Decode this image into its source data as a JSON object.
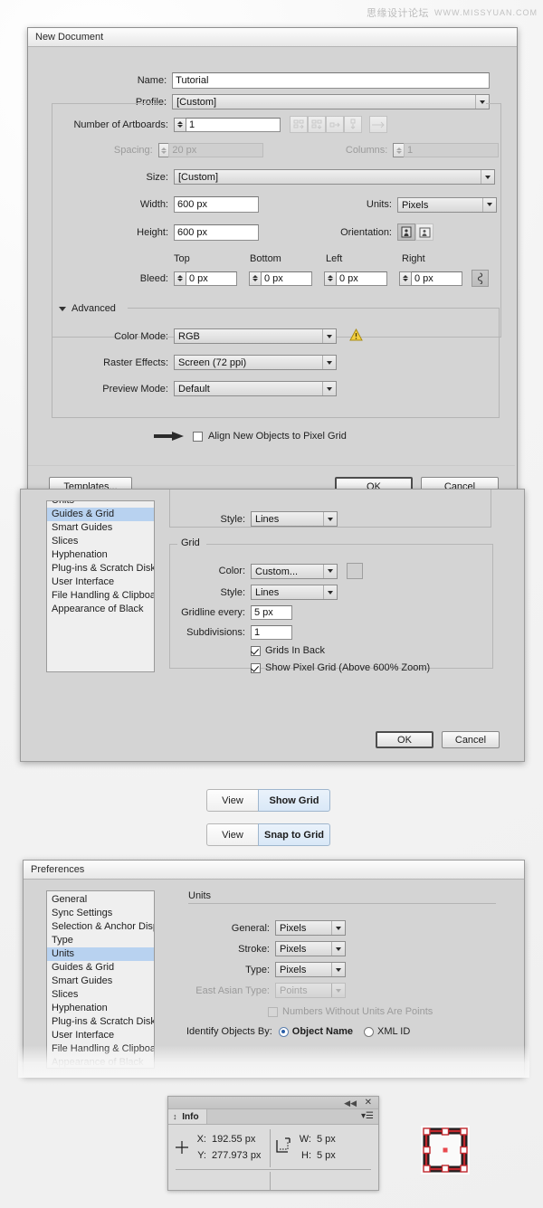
{
  "watermark": {
    "cn": "思缘设计论坛",
    "en": "WWW.MISSYUAN.COM"
  },
  "new_document": {
    "title": "New Document",
    "name_label": "Name:",
    "name_value": "Tutorial",
    "profile_label": "Profile:",
    "profile_value": "[Custom]",
    "artboards_label": "Number of Artboards:",
    "artboards_value": "1",
    "spacing_label": "Spacing:",
    "spacing_value": "20 px",
    "columns_label": "Columns:",
    "columns_value": "1",
    "size_label": "Size:",
    "size_value": "[Custom]",
    "width_label": "Width:",
    "width_value": "600 px",
    "units_label": "Units:",
    "units_value": "Pixels",
    "height_label": "Height:",
    "height_value": "600 px",
    "orientation_label": "Orientation:",
    "bleed_label": "Bleed:",
    "bleed_top_label": "Top",
    "bleed_top_value": "0 px",
    "bleed_bottom_label": "Bottom",
    "bleed_bottom_value": "0 px",
    "bleed_left_label": "Left",
    "bleed_left_value": "0 px",
    "bleed_right_label": "Right",
    "bleed_right_value": "0 px",
    "advanced_label": "Advanced",
    "color_mode_label": "Color Mode:",
    "color_mode_value": "RGB",
    "raster_label": "Raster Effects:",
    "raster_value": "Screen (72 ppi)",
    "preview_label": "Preview Mode:",
    "preview_value": "Default",
    "align_pixel_label": "Align New Objects to Pixel Grid",
    "align_pixel_checked": false,
    "templates_label": "Templates...",
    "ok_label": "OK",
    "cancel_label": "Cancel"
  },
  "prefs_grid": {
    "categories": [
      {
        "label": "Units",
        "selected": false,
        "dim": false,
        "clipped": true
      },
      {
        "label": "Guides & Grid",
        "selected": true,
        "dim": false
      },
      {
        "label": "Smart Guides",
        "selected": false,
        "dim": false
      },
      {
        "label": "Slices",
        "selected": false,
        "dim": false
      },
      {
        "label": "Hyphenation",
        "selected": false,
        "dim": false
      },
      {
        "label": "Plug-ins & Scratch Disks",
        "selected": false,
        "dim": false
      },
      {
        "label": "User Interface",
        "selected": false,
        "dim": false
      },
      {
        "label": "File Handling & Clipboard",
        "selected": false,
        "dim": false
      },
      {
        "label": "Appearance of Black",
        "selected": false,
        "dim": false
      }
    ],
    "guides_style_label": "Style:",
    "guides_style_value": "Lines",
    "grid_legend": "Grid",
    "grid_color_label": "Color:",
    "grid_color_value": "Custom...",
    "grid_style_label": "Style:",
    "grid_style_value": "Lines",
    "gridline_label": "Gridline every:",
    "gridline_value": "5 px",
    "subdivisions_label": "Subdivisions:",
    "subdivisions_value": "1",
    "grids_in_back_label": "Grids In Back",
    "grids_in_back_checked": true,
    "show_pixel_grid_label": "Show Pixel Grid (Above 600% Zoom)",
    "show_pixel_grid_checked": true,
    "ok_label": "OK",
    "cancel_label": "Cancel"
  },
  "menu_hints": [
    {
      "menu": "View",
      "item": "Show Grid"
    },
    {
      "menu": "View",
      "item": "Snap to Grid"
    }
  ],
  "prefs_units": {
    "title": "Preferences",
    "categories": [
      {
        "label": "General",
        "selected": false,
        "dim": false
      },
      {
        "label": "Sync Settings",
        "selected": false,
        "dim": false
      },
      {
        "label": "Selection & Anchor Display",
        "selected": false,
        "dim": false
      },
      {
        "label": "Type",
        "selected": false,
        "dim": false
      },
      {
        "label": "Units",
        "selected": true,
        "dim": false
      },
      {
        "label": "Guides & Grid",
        "selected": false,
        "dim": false
      },
      {
        "label": "Smart Guides",
        "selected": false,
        "dim": false
      },
      {
        "label": "Slices",
        "selected": false,
        "dim": false
      },
      {
        "label": "Hyphenation",
        "selected": false,
        "dim": false
      },
      {
        "label": "Plug-ins & Scratch Disks",
        "selected": false,
        "dim": false
      },
      {
        "label": "User Interface",
        "selected": false,
        "dim": false
      },
      {
        "label": "File Handling & Clipboard",
        "selected": false,
        "dim": false
      },
      {
        "label": "Appearance of Black",
        "selected": false,
        "dim": true
      }
    ],
    "section_label": "Units",
    "general_label": "General:",
    "general_value": "Pixels",
    "stroke_label": "Stroke:",
    "stroke_value": "Pixels",
    "type_label": "Type:",
    "type_value": "Pixels",
    "east_asian_label": "East Asian Type:",
    "east_asian_value": "Points",
    "numbers_label": "Numbers Without Units Are Points",
    "numbers_checked": false,
    "identify_label": "Identify Objects By:",
    "identify_object_name": "Object Name",
    "identify_xml_id": "XML ID",
    "identify_selected": "Object Name"
  },
  "info_panel": {
    "tab_label": "Info",
    "x_label": "X:",
    "x_value": "192.55 px",
    "y_label": "Y:",
    "y_value": "277.973 px",
    "w_label": "W:",
    "w_value": "5 px",
    "h_label": "H:",
    "h_value": "5 px"
  },
  "colors": {
    "dialog_bg": "#d4d4d4",
    "selection_blue": "#b8d2f0",
    "warning_yellow": "#f0c020",
    "accent_red": "#c0272d"
  }
}
